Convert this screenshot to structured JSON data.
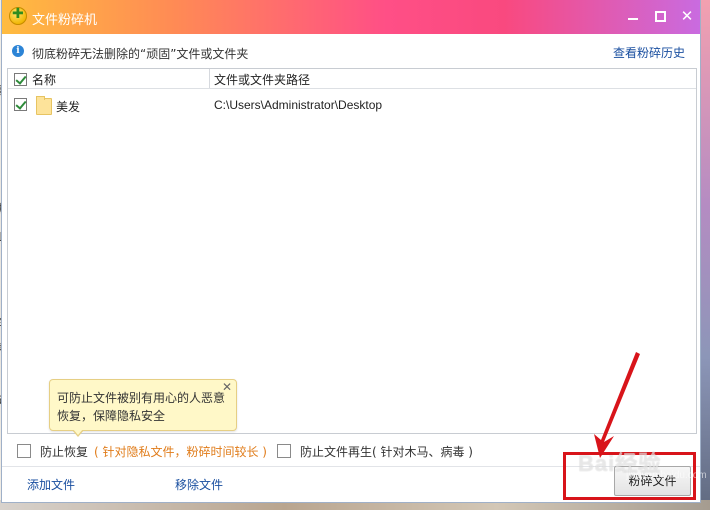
{
  "window": {
    "title": "文件粉碎机"
  },
  "info_bar": {
    "text": "彻底粉碎无法删除的“顽固”文件或文件夹",
    "history_link": "查看粉碎历史"
  },
  "list": {
    "columns": [
      "名称",
      "文件或文件夹路径"
    ],
    "rows": [
      {
        "name": "美发",
        "path": "C:\\Users\\Administrator\\Desktop",
        "checked": true
      }
    ]
  },
  "tooltip": {
    "text": "可防止文件被别有用心的人恶意恢复，保障隐私安全"
  },
  "options": {
    "prevent_recovery": {
      "label": "防止恢复",
      "note": "( 针对隐私文件，粉碎时间较长 )",
      "checked": false
    },
    "prevent_regeneration": {
      "label": "防止文件再生",
      "note": "( 针对木马、病毒 )",
      "checked": false
    }
  },
  "actions": {
    "add_files": "添加文件",
    "remove_files": "移除文件",
    "shred": "粉碎文件"
  },
  "background_fragments": [
    "瞏",
    "加",
    "L",
    "全",
    "看",
    "可"
  ],
  "watermark": {
    "text": "Bai经验",
    "sub": "jingyan.baidu.com"
  },
  "colors": {
    "title_gradient_start": "#ffbc3f",
    "title_gradient_end": "#c96be0",
    "link": "#1a4fa0",
    "note_orange": "#e07c1a",
    "annotation_red": "#d8141a"
  }
}
